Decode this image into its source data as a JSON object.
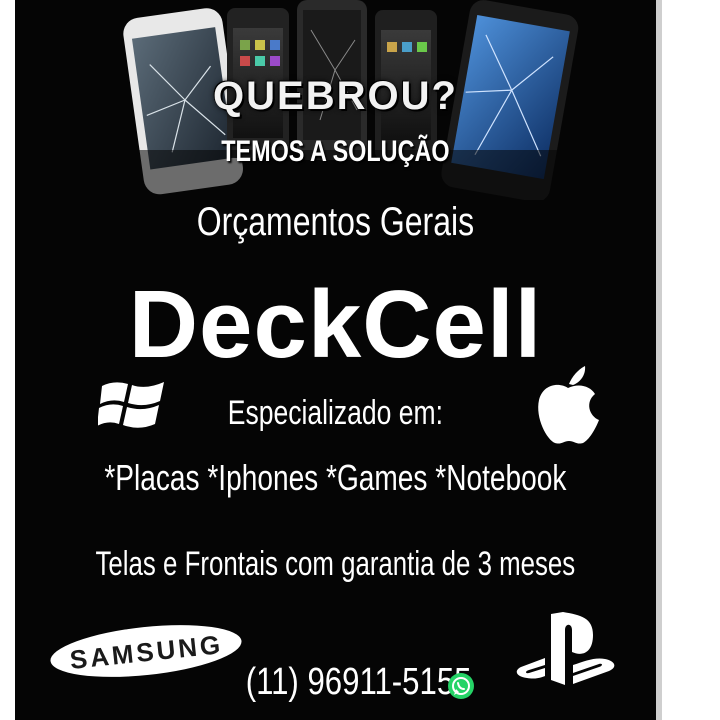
{
  "flyer": {
    "headline": "QUEBROU?",
    "subheadline": "TEMOS A SOLUÇÃO",
    "quotes": "Orçamentos Gerais",
    "brand_name": "DeckCell",
    "specialized": "Especializado em:",
    "services": "*Placas *Iphones *Games *Notebook",
    "warranty": "Telas e Frontais com garantia de 3 meses",
    "phone": "(11) 96911-5155",
    "samsung_logo_text": "SAMSUNG"
  },
  "icons": {
    "top_left": "windows-logo-icon",
    "top_right": "apple-logo-icon",
    "bottom_left": "samsung-logo",
    "bottom_right": "playstation-logo-icon",
    "phone_suffix": "whatsapp-icon"
  },
  "colors": {
    "background": "#050505",
    "text": "#ffffff",
    "whatsapp": "#25d366"
  }
}
